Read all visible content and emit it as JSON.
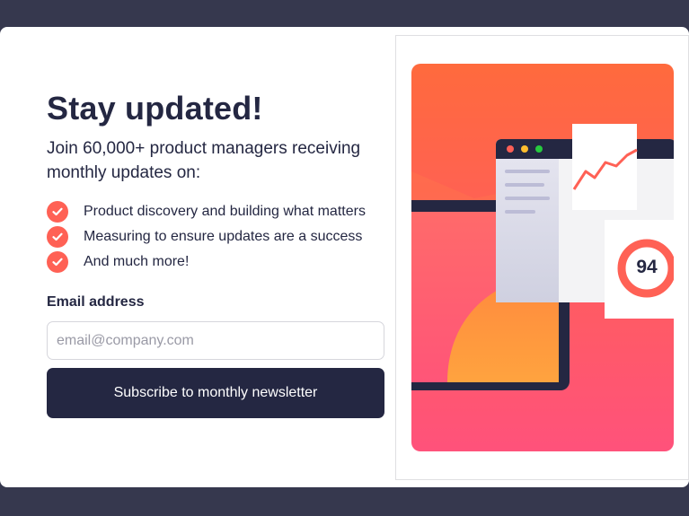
{
  "card": {
    "title": "Stay updated!",
    "intro": "Join 60,000+ product managers receiving monthly updates on:",
    "features": [
      "Product discovery and building what matters",
      "Measuring to ensure updates are a success",
      "And much more!"
    ],
    "email_label": "Email address",
    "email_placeholder": "email@company.com",
    "email_value": "",
    "subscribe_label": "Subscribe to monthly newsletter"
  },
  "illustration": {
    "score": "94"
  },
  "colors": {
    "background": "#36384e",
    "dark_navy": "#242742",
    "tomato": "#ff6155",
    "card": "#ffffff"
  },
  "icons": [
    "check-icon"
  ]
}
